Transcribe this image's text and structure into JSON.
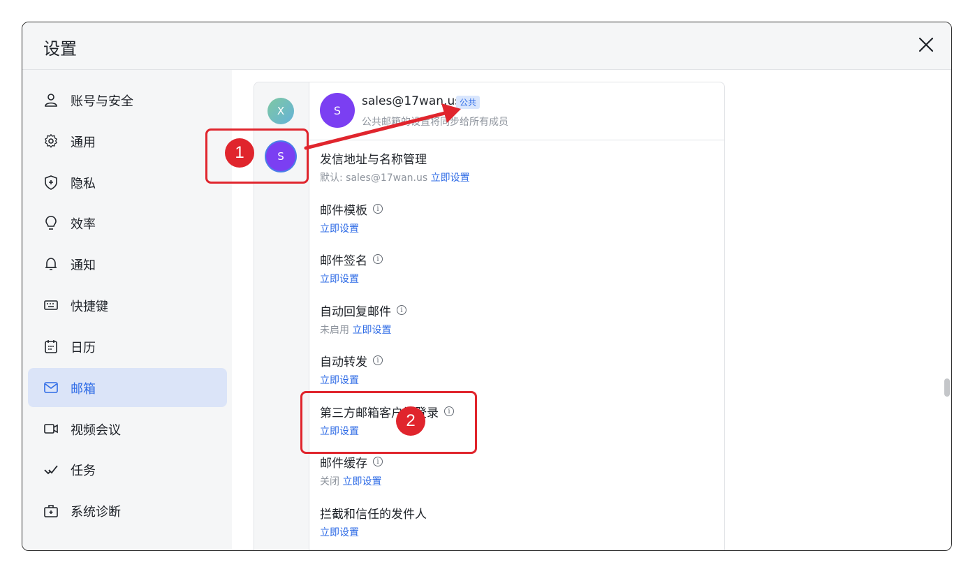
{
  "window": {
    "title": "设置"
  },
  "sidebar": {
    "items": [
      {
        "label": "账号与安全",
        "icon": "user-icon"
      },
      {
        "label": "通用",
        "icon": "gear-icon"
      },
      {
        "label": "隐私",
        "icon": "shield-icon"
      },
      {
        "label": "效率",
        "icon": "lightbulb-icon"
      },
      {
        "label": "通知",
        "icon": "bell-icon"
      },
      {
        "label": "快捷键",
        "icon": "keyboard-icon"
      },
      {
        "label": "日历",
        "icon": "calendar-icon"
      },
      {
        "label": "邮箱",
        "icon": "mail-icon",
        "active": true
      },
      {
        "label": "视频会议",
        "icon": "video-icon"
      },
      {
        "label": "任务",
        "icon": "task-check-icon"
      },
      {
        "label": "系统诊断",
        "icon": "toolbox-icon"
      }
    ]
  },
  "accounts": [
    {
      "initial": "X"
    },
    {
      "initial": "S",
      "selected": true
    }
  ],
  "mailbox": {
    "avatar": "S",
    "email": "sales@17wan.us",
    "badge": "公共",
    "subtitle": "公共邮箱的设置将同步给所有成员"
  },
  "settings": [
    {
      "title": "发信地址与名称管理",
      "status": "默认: sales@17wan.us",
      "link": "立即设置",
      "info": false
    },
    {
      "title": "邮件模板",
      "status": "",
      "link": "立即设置",
      "info": true
    },
    {
      "title": "邮件签名",
      "status": "",
      "link": "立即设置",
      "info": true
    },
    {
      "title": "自动回复邮件",
      "status": "未启用",
      "link": "立即设置",
      "info": true
    },
    {
      "title": "自动转发",
      "status": "",
      "link": "立即设置",
      "info": true
    },
    {
      "title": "第三方邮箱客户端登录",
      "status": "",
      "link": "立即设置",
      "info": true
    },
    {
      "title": "邮件缓存",
      "status": "关闭",
      "link": "立即设置",
      "info": true
    },
    {
      "title": "拦截和信任的发件人",
      "status": "",
      "link": "立即设置",
      "info": false
    }
  ],
  "annotations": {
    "step1": "1",
    "step2": "2",
    "color": "#e0252d"
  },
  "colors": {
    "accent": "#2e6be6",
    "avatar": "#7b3ff2",
    "active_bg": "#dbe4f8"
  }
}
